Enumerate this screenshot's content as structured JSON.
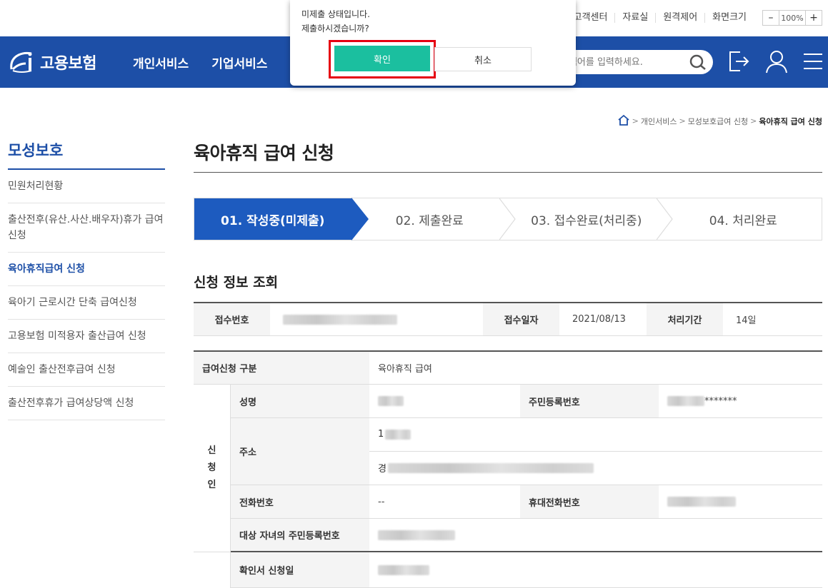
{
  "util": {
    "links": [
      "고객센터",
      "자료실",
      "원격제어"
    ],
    "zoom_label": "화면크기",
    "zoom_minus": "–",
    "zoom_value": "100%",
    "zoom_plus": "+"
  },
  "header": {
    "logo_text": "고용보험",
    "nav": [
      "개인서비스",
      "기업서비스"
    ],
    "search_placeholder": "검색어를 입력하세요.",
    "bg_color": "#1d4fa7"
  },
  "popup": {
    "message_line1": "미제출 상태입니다.",
    "message_line2": "제출하시겠습니까?",
    "confirm_label": "확인",
    "cancel_label": "취소",
    "confirm_color": "#1bbf9f",
    "highlight_color": "#e60012"
  },
  "breadcrumb": [
    "개인서비스",
    "모성보호급여 신청",
    "육아휴직 급여 신청"
  ],
  "lnb": {
    "title": "모성보호",
    "items": [
      "민원처리현황",
      "출산전후(유산.사산.배우자)휴가 급여신청",
      "육아휴직급여 신청",
      "육아기 근로시간 단축 급여신청",
      "고용보험 미적용자 출산급여 신청",
      "예술인 출산전후급여 신청",
      "출산전후휴가 급여상당액 신청"
    ],
    "active_index": 2
  },
  "page": {
    "title": "육아휴직 급여 신청",
    "steps": [
      "01. 작성중(미제출)",
      "02. 제출완료",
      "03. 접수완료(처리중)",
      "04. 처리완료"
    ],
    "active_step": 0,
    "section_title": "신청 정보 조회"
  },
  "info": {
    "receipt_no_label": "접수번호",
    "receipt_date_label": "접수일자",
    "receipt_date": "2021/08/13",
    "period_label": "처리기간",
    "period": "14일"
  },
  "detail": {
    "category_label": "급여신청 구분",
    "category_value": "육아휴직 급여",
    "applicant_label": "신청인",
    "applicant_chars": [
      "신",
      "청",
      "인"
    ],
    "name_label": "성명",
    "rrn_label": "주민등록번호",
    "rrn_mask": "*******",
    "address_label": "주소",
    "address_line1_prefix": "1",
    "address_line2_prefix": "경",
    "phone_label": "전화번호",
    "phone_value": "--",
    "mobile_label": "휴대전화번호",
    "child_rrn_label": "대상 자녀의 주민등록번호",
    "confirm_date_label": "확인서 신청일"
  }
}
